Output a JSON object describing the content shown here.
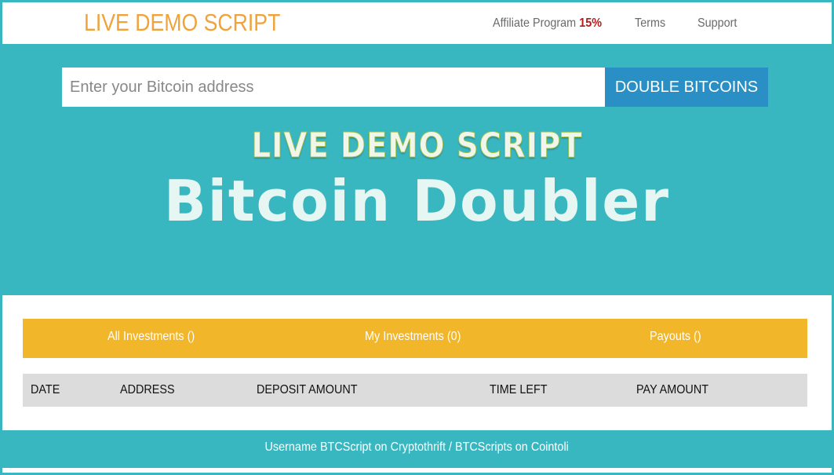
{
  "navbar": {
    "brand": "LIVE DEMO SCRIPT",
    "affiliate_label": "Affiliate Program",
    "affiliate_percent": "15%",
    "terms_label": "Terms",
    "support_label": "Support"
  },
  "hero": {
    "address_placeholder": "Enter your Bitcoin address",
    "button_label": "DOUBLE BITCOINS",
    "title_line1": "LIVE DEMO SCRIPT",
    "title_line2": "Bitcoin Doubler"
  },
  "tabs": [
    {
      "label": "All Investments ()"
    },
    {
      "label": "My Investments (0)"
    },
    {
      "label": "Payouts ()"
    }
  ],
  "table": {
    "columns": [
      "DATE",
      "ADDRESS",
      "DEPOSIT AMOUNT",
      "TIME LEFT",
      "PAY AMOUNT"
    ],
    "rows": []
  },
  "footer": {
    "text": "Username BTCScript on Cryptothrift / BTCScripts on Cointoli"
  },
  "colors": {
    "background": "#39b7c1",
    "brand": "#f0a33a",
    "affiliate_percent": "#b31d1d",
    "button": "#2a8fc4",
    "tab_bar": "#f2b62a",
    "table_header": "#dcdcdc"
  }
}
